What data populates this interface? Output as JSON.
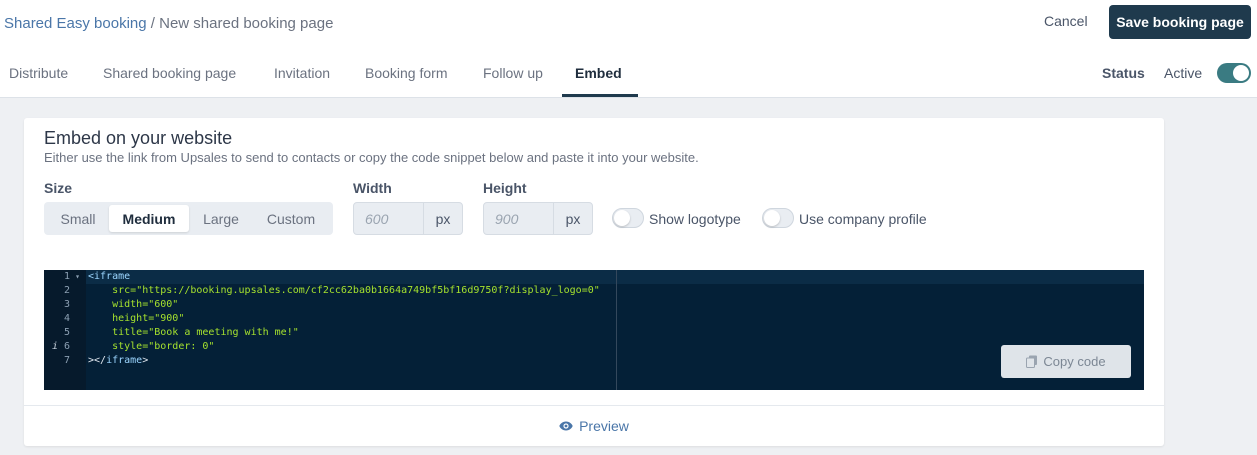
{
  "header": {
    "breadcrumb_parent": "Shared Easy booking",
    "breadcrumb_separator": "/",
    "breadcrumb_current": "New shared booking page",
    "cancel_label": "Cancel",
    "save_label": "Save booking page"
  },
  "tabs": [
    {
      "label": "Distribute",
      "active": false
    },
    {
      "label": "Shared booking page",
      "active": false
    },
    {
      "label": "Invitation",
      "active": false
    },
    {
      "label": "Booking form",
      "active": false
    },
    {
      "label": "Follow up",
      "active": false
    },
    {
      "label": "Embed",
      "active": true
    }
  ],
  "status": {
    "label": "Status",
    "value_label": "Active",
    "enabled": true
  },
  "embed": {
    "title": "Embed on your website",
    "subtitle": "Either use the link from Upsales to send to contacts or copy the code snippet below and paste it into your website.",
    "size_label": "Size",
    "size_options": [
      "Small",
      "Medium",
      "Large",
      "Custom"
    ],
    "size_selected": "Medium",
    "width_label": "Width",
    "width_placeholder": "600",
    "width_unit": "px",
    "height_label": "Height",
    "height_placeholder": "900",
    "height_unit": "px",
    "show_logotype_label": "Show logotype",
    "show_logotype_enabled": false,
    "use_company_profile_label": "Use company profile",
    "use_company_profile_enabled": false
  },
  "code": {
    "line_numbers": [
      "1",
      "2",
      "3",
      "4",
      "5",
      "6",
      "7"
    ],
    "info_marker": "i",
    "lines": {
      "l1_open": "<iframe",
      "l2_attr": "src=",
      "l2_val": "\"https://booking.upsales.com/cf2cc62ba0b1664a749bf5bf16d9750f?display_logo=0\"",
      "l3_attr": "width=",
      "l3_val": "\"600\"",
      "l4_attr": "height=",
      "l4_val": "\"900\"",
      "l5_attr": "title=",
      "l5_val": "\"Book a meeting with me!\"",
      "l6_attr": "style=",
      "l6_val": "\"border: 0\"",
      "l7_close_punct": "></",
      "l7_close_tag": "iframe",
      "l7_end": ">"
    },
    "copy_label": "Copy code"
  },
  "preview": {
    "label": "Preview"
  },
  "colors": {
    "primary": "#1f3a4d",
    "toggle_active": "#3a7b82",
    "link": "#4a76a8",
    "code_bg": "#042037"
  },
  "icons": {
    "copy": "copy-icon",
    "preview": "eye-icon",
    "fold": "fold-arrow-icon"
  }
}
